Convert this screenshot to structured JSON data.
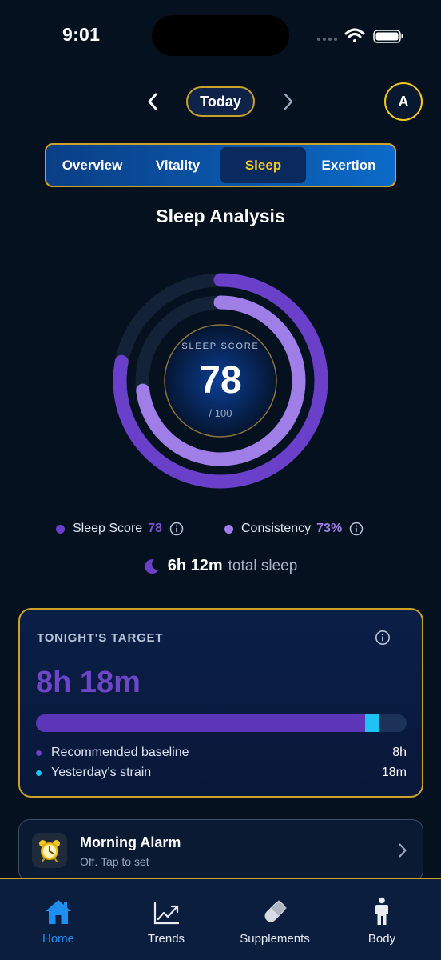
{
  "status_bar": {
    "time": "9:01"
  },
  "date_nav": {
    "label": "Today"
  },
  "profile": {
    "initial": "A"
  },
  "tabs": [
    {
      "label": "Overview",
      "active": false
    },
    {
      "label": "Vitality",
      "active": false
    },
    {
      "label": "Sleep",
      "active": true
    },
    {
      "label": "Exertion",
      "active": false
    }
  ],
  "section_title": "Sleep Analysis",
  "sleep_score": {
    "label": "SLEEP SCORE",
    "value": "78",
    "max_label": "/ 100",
    "score_fraction": 0.78,
    "consistency_fraction": 0.73
  },
  "legend": {
    "score": {
      "label": "Sleep Score",
      "value": "78",
      "color": "#6a3fc9"
    },
    "consistency": {
      "label": "Consistency",
      "value": "73%",
      "color": "#a07ee8"
    }
  },
  "total_sleep": {
    "value": "6h 12m",
    "suffix": "total sleep"
  },
  "target_card": {
    "title": "TONIGHT'S TARGET",
    "value": "8h 18m",
    "baseline": {
      "label": "Recommended baseline",
      "value": "8h",
      "color": "#6a3fc9"
    },
    "strain": {
      "label": "Yesterday's strain",
      "value": "18m",
      "color": "#1ec2f4"
    },
    "bar_baseline_fraction": 0.888,
    "bar_strain_fraction": 0.037
  },
  "alarm": {
    "title": "Morning Alarm",
    "subtitle": "Off. Tap to set"
  },
  "bottom_nav": [
    {
      "label": "Home",
      "icon": "home-icon",
      "active": true
    },
    {
      "label": "Trends",
      "icon": "trends-icon",
      "active": false
    },
    {
      "label": "Supplements",
      "icon": "pill-icon",
      "active": false
    },
    {
      "label": "Body",
      "icon": "body-icon",
      "active": false
    }
  ]
}
